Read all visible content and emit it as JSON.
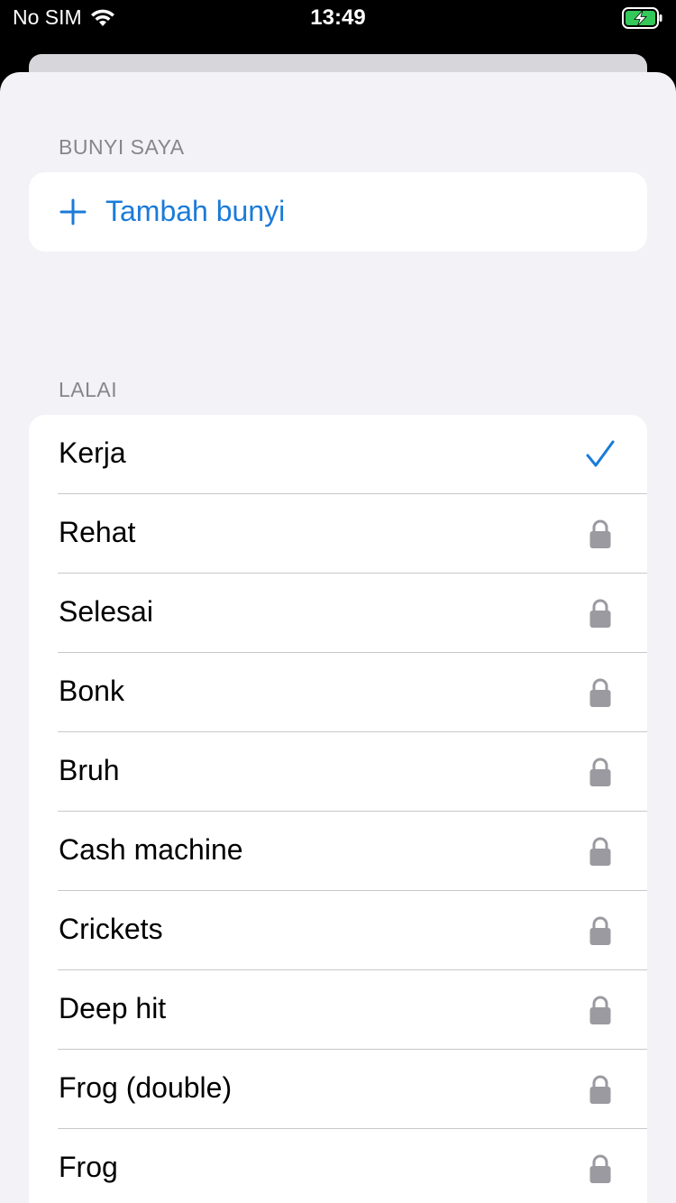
{
  "status_bar": {
    "carrier": "No SIM",
    "time": "13:49"
  },
  "my_sounds": {
    "header": "BUNYI SAYA",
    "add_label": "Tambah bunyi"
  },
  "default_sounds": {
    "header": "LALAI",
    "items": [
      {
        "label": "Kerja",
        "state": "selected"
      },
      {
        "label": "Rehat",
        "state": "locked"
      },
      {
        "label": "Selesai",
        "state": "locked"
      },
      {
        "label": "Bonk",
        "state": "locked"
      },
      {
        "label": "Bruh",
        "state": "locked"
      },
      {
        "label": "Cash machine",
        "state": "locked"
      },
      {
        "label": "Crickets",
        "state": "locked"
      },
      {
        "label": "Deep hit",
        "state": "locked"
      },
      {
        "label": "Frog (double)",
        "state": "locked"
      },
      {
        "label": "Frog",
        "state": "locked"
      }
    ]
  },
  "colors": {
    "accent": "#1a7bd8",
    "lock": "#9a9aa0",
    "battery": "#34c759"
  }
}
